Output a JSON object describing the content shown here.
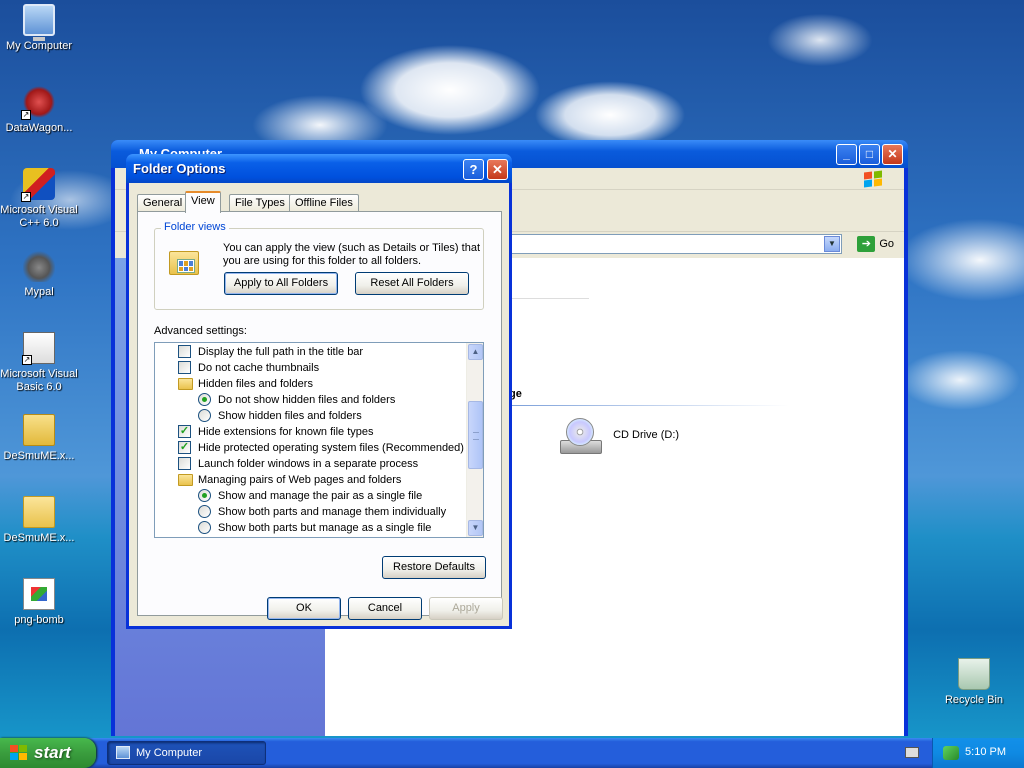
{
  "desktop": {
    "icons": [
      {
        "label": "My Computer",
        "icon": "my-computer-icon"
      },
      {
        "label": "DataWagon...",
        "icon": "datawagon-icon"
      },
      {
        "label": "Microsoft Visual C++ 6.0",
        "icon": "visual-cpp-icon"
      },
      {
        "label": "Mypal",
        "icon": "mypal-icon"
      },
      {
        "label": "Microsoft Visual Basic 6.0",
        "icon": "visual-basic-icon"
      },
      {
        "label": "DeSmuME.x...",
        "icon": "zip-folder-icon"
      },
      {
        "label": "DeSmuME.x...",
        "icon": "folder-icon"
      },
      {
        "label": "png-bomb",
        "icon": "png-file-icon"
      },
      {
        "label": "Recycle Bin",
        "icon": "recycle-bin-icon"
      }
    ]
  },
  "explorer": {
    "title": "My Computer",
    "go_label": "Go",
    "section_label": "ge",
    "drive_label": "CD Drive (D:)"
  },
  "dialog": {
    "title": "Folder Options",
    "tabs": [
      "General",
      "View",
      "File Types",
      "Offline Files"
    ],
    "active_tab": "View",
    "folder_views": {
      "legend": "Folder views",
      "description": "You can apply the view (such as Details or Tiles) that you are using for this folder to all folders.",
      "apply_all": "Apply to All Folders",
      "reset_all": "Reset All Folders"
    },
    "advanced_label": "Advanced settings:",
    "settings": [
      {
        "type": "checkbox",
        "checked": false,
        "indent": 0,
        "label": "Display the full path in the title bar"
      },
      {
        "type": "checkbox",
        "checked": false,
        "indent": 0,
        "label": "Do not cache thumbnails"
      },
      {
        "type": "folder",
        "indent": 0,
        "label": "Hidden files and folders"
      },
      {
        "type": "radio",
        "checked": true,
        "indent": 1,
        "label": "Do not show hidden files and folders"
      },
      {
        "type": "radio",
        "checked": false,
        "indent": 1,
        "label": "Show hidden files and folders"
      },
      {
        "type": "checkbox",
        "checked": true,
        "indent": 0,
        "label": "Hide extensions for known file types"
      },
      {
        "type": "checkbox",
        "checked": true,
        "indent": 0,
        "label": "Hide protected operating system files (Recommended)"
      },
      {
        "type": "checkbox",
        "checked": false,
        "indent": 0,
        "label": "Launch folder windows in a separate process"
      },
      {
        "type": "folder",
        "indent": 0,
        "label": "Managing pairs of Web pages and folders"
      },
      {
        "type": "radio",
        "checked": true,
        "indent": 1,
        "label": "Show and manage the pair as a single file"
      },
      {
        "type": "radio",
        "checked": false,
        "indent": 1,
        "label": "Show both parts and manage them individually"
      },
      {
        "type": "radio",
        "checked": false,
        "indent": 1,
        "label": "Show both parts but manage as a single file"
      }
    ],
    "restore_defaults": "Restore Defaults",
    "ok": "OK",
    "cancel": "Cancel",
    "apply": "Apply"
  },
  "taskbar": {
    "start_label": "start",
    "task_label": "My Computer",
    "clock": "5:10 PM"
  }
}
